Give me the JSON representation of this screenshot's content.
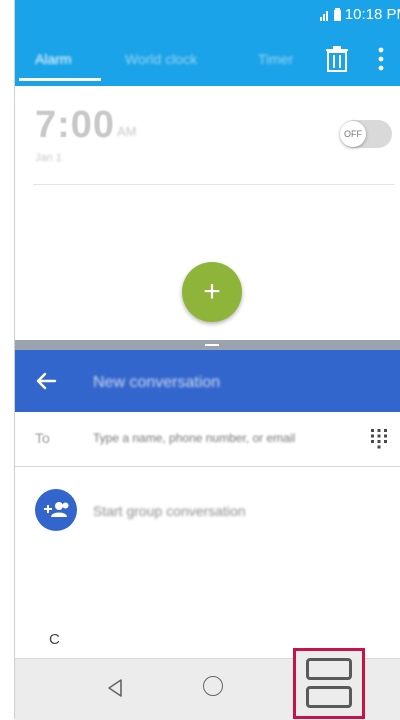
{
  "status_bar": {
    "time": "10:18 PM"
  },
  "clock_app": {
    "tabs": [
      {
        "label": "Alarm",
        "active": true
      },
      {
        "label": "World clock",
        "active": false
      },
      {
        "label": "Timer",
        "active": false
      }
    ],
    "icons": {
      "delete": "trash-icon",
      "more": "more-vert-icon"
    },
    "alarm": {
      "time": "7:00",
      "ampm": "AM",
      "date": "Jan 1",
      "toggle_label": "OFF"
    },
    "fab_icon": "+"
  },
  "messaging_app": {
    "title": "New conversation",
    "to_label": "To",
    "to_placeholder": "Type a name, phone number, or email",
    "group_conversation_label": "Start group conversation",
    "scroll_index_letter": "C"
  },
  "colors": {
    "clock_accent": "#1aa3e8",
    "messaging_accent": "#3366cc",
    "fab": "#8fb43a",
    "highlight_box": "#c41448"
  }
}
